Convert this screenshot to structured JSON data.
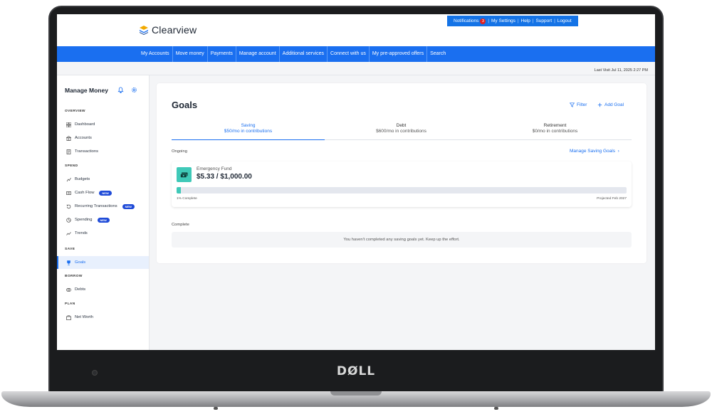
{
  "device": {
    "brand": "DØLL"
  },
  "app": {
    "logo_text": "Clearview"
  },
  "utility_bar": {
    "notifications_label": "Notifications",
    "notifications_count": "3",
    "items": [
      "My Settings",
      "Help",
      "Support",
      "Logout"
    ]
  },
  "nav": {
    "items": [
      "My Accounts",
      "Move money",
      "Payments",
      "Manage account",
      "Additional services",
      "Connect with us",
      "My pre-approved offers",
      "Search"
    ]
  },
  "last_visit": "Last Visit Jul 11, 2025 2:27 PM",
  "sidebar": {
    "title": "Manage Money",
    "sections": {
      "overview": "OVERVIEW",
      "spend": "SPEND",
      "save": "SAVE",
      "borrow": "BORROW",
      "plan": "PLAN"
    },
    "items": [
      {
        "label": "Dashboard",
        "icon": "grid-icon"
      },
      {
        "label": "Accounts",
        "icon": "bank-icon"
      },
      {
        "label": "Transactions",
        "icon": "receipt-icon"
      },
      {
        "label": "Budgets",
        "icon": "budget-icon"
      },
      {
        "label": "Cash Flow",
        "icon": "cash-flow-icon",
        "badge": "NEW"
      },
      {
        "label": "Recurring Transactions",
        "icon": "recurring-icon",
        "badge": "NEW"
      },
      {
        "label": "Spending",
        "icon": "spending-icon",
        "badge": "NEW"
      },
      {
        "label": "Trends",
        "icon": "trends-icon"
      },
      {
        "label": "Goals",
        "icon": "trophy-icon",
        "active": true
      },
      {
        "label": "Debts",
        "icon": "debts-icon"
      },
      {
        "label": "Net Worth",
        "icon": "net-worth-icon"
      }
    ]
  },
  "goals": {
    "title": "Goals",
    "filter_label": "Filter",
    "add_goal_label": "Add Goal",
    "tabs": [
      {
        "name": "Saving",
        "sub": "$50/mo in contributions",
        "active": true
      },
      {
        "name": "Debt",
        "sub": "$600/mo in contributions"
      },
      {
        "name": "Retirement",
        "sub": "$0/mo in contributions"
      }
    ],
    "ongoing_label": "Ongoing",
    "manage_link": "Manage Saving Goals",
    "fund": {
      "name": "Emergency Fund",
      "amount": "$5.33 / $1,000.00",
      "progress_fraction": 0.01,
      "progress_text": "1% Complete",
      "projected_text": "Projected Feb 2027"
    },
    "complete_label": "Complete",
    "empty_message": "You haven't completed any saving goals yet. Keep up the effort."
  },
  "colors": {
    "accent": "#1a6ff0",
    "teal": "#3fc9b8",
    "badge": "#1f4bd8"
  }
}
